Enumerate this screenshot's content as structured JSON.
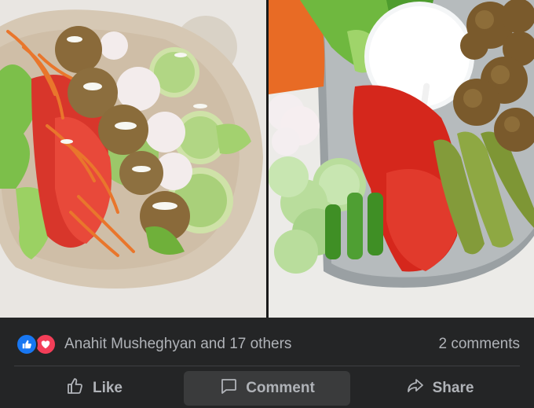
{
  "post": {
    "image_left_alt": "",
    "image_right_alt": ""
  },
  "reactions": {
    "summary": "Anahit Musheghyan and 17 others",
    "icons": [
      "like-reaction-icon",
      "love-reaction-icon"
    ],
    "colors": {
      "like": "#1877f2",
      "love": "#f33e58"
    }
  },
  "comments": {
    "count_label": "2 comments"
  },
  "actions": {
    "like_label": "Like",
    "comment_label": "Comment",
    "share_label": "Share"
  }
}
